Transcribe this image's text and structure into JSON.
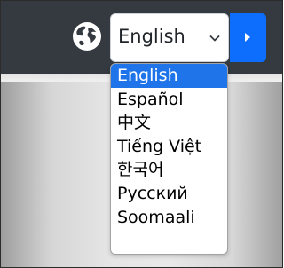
{
  "language_selector": {
    "selected": "English",
    "options": [
      "English",
      "Español",
      "中文",
      "Tiếng Việt",
      "한국어",
      "Русский",
      "Soomaali"
    ]
  },
  "icons": {
    "globe": "globe-icon",
    "caret": "chevron-down-icon",
    "submit": "play-arrow-icon"
  },
  "colors": {
    "topbar": "#343a40",
    "accent": "#0d6efd",
    "selected_option": "#1e74e8"
  }
}
